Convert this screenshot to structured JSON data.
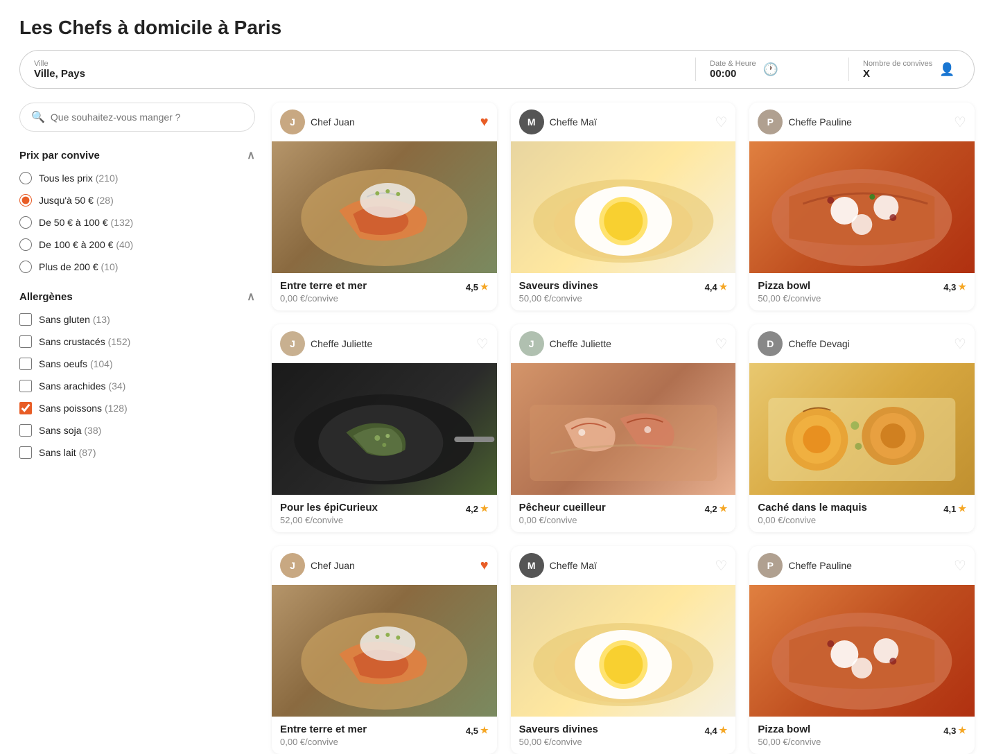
{
  "page": {
    "title": "Les Chefs à domicile à Paris"
  },
  "searchBar": {
    "city_label": "Ville",
    "city_placeholder": "Ville, Pays",
    "city_value": "Ville, Pays",
    "datetime_label": "Date & Heure",
    "datetime_value": "00:00",
    "guests_label": "Nombre de convives",
    "guests_value": "X"
  },
  "sidebar": {
    "search_placeholder": "Que souhaitez-vous manger ?",
    "price_section_label": "Prix par convive",
    "price_options": [
      {
        "id": "all",
        "label": "Tous les prix",
        "count": 210,
        "selected": false
      },
      {
        "id": "under50",
        "label": "Jusqu'à 50 €",
        "count": 28,
        "selected": true
      },
      {
        "id": "50to100",
        "label": "De 50 € à 100 €",
        "count": 132,
        "selected": false
      },
      {
        "id": "100to200",
        "label": "De 100 € à 200 €",
        "count": 40,
        "selected": false
      },
      {
        "id": "over200",
        "label": "Plus de 200 €",
        "count": 10,
        "selected": false
      }
    ],
    "allergens_section_label": "Allergènes",
    "allergen_options": [
      {
        "id": "gluten",
        "label": "Sans gluten",
        "count": 13,
        "checked": false
      },
      {
        "id": "crustaces",
        "label": "Sans crustacés",
        "count": 152,
        "checked": false
      },
      {
        "id": "oeufs",
        "label": "Sans oeufs",
        "count": 104,
        "checked": false
      },
      {
        "id": "arachides",
        "label": "Sans arachides",
        "count": 34,
        "checked": false
      },
      {
        "id": "poissons",
        "label": "Sans poissons",
        "count": 128,
        "checked": true
      },
      {
        "id": "soja",
        "label": "Sans soja",
        "count": 38,
        "checked": false
      },
      {
        "id": "lait",
        "label": "Sans lait",
        "count": 87,
        "checked": false
      }
    ]
  },
  "cards": [
    {
      "chef_name": "Chef Juan",
      "chef_avatar_initials": "J",
      "chef_avatar_color": "#c8a882",
      "dish_name": "Entre terre et mer",
      "price": "0,00 €/convive",
      "rating": "4,5",
      "favorited": true,
      "image_color": "#b5a080",
      "image_secondary": "#7a8a60"
    },
    {
      "chef_name": "Cheffe Maï",
      "chef_avatar_initials": "M",
      "chef_avatar_color": "#555",
      "dish_name": "Saveurs divines",
      "price": "50,00 €/convive",
      "rating": "4,4",
      "favorited": false,
      "image_color": "#e8d5a0",
      "image_secondary": "#ffffff"
    },
    {
      "chef_name": "Cheffe Pauline",
      "chef_avatar_initials": "P",
      "chef_avatar_color": "#b0a090",
      "dish_name": "Pizza bowl",
      "price": "50,00 €/convive",
      "rating": "4,3",
      "favorited": false,
      "image_color": "#e08040",
      "image_secondary": "#cc4422"
    },
    {
      "chef_name": "Cheffe Juliette",
      "chef_avatar_initials": "J",
      "chef_avatar_color": "#c8b090",
      "dish_name": "Pour les épiCurieux",
      "price": "52,00 €/convive",
      "rating": "4,2",
      "favorited": false,
      "image_color": "#2a2a2a",
      "image_secondary": "#5a7040"
    },
    {
      "chef_name": "Cheffe Juliette",
      "chef_avatar_initials": "J",
      "chef_avatar_color": "#b0c0b0",
      "dish_name": "Pêcheur cueilleur",
      "price": "0,00 €/convive",
      "rating": "4,2",
      "favorited": false,
      "image_color": "#d4956a",
      "image_secondary": "#c07050"
    },
    {
      "chef_name": "Cheffe Devagi",
      "chef_avatar_initials": "D",
      "chef_avatar_color": "#888",
      "dish_name": "Caché dans le maquis",
      "price": "0,00 €/convive",
      "rating": "4,1",
      "favorited": false,
      "image_color": "#e8c870",
      "image_secondary": "#c8a840"
    },
    {
      "chef_name": "Chef Juan",
      "chef_avatar_initials": "J",
      "chef_avatar_color": "#c8a882",
      "dish_name": "Entre terre et mer",
      "price": "0,00 €/convive",
      "rating": "4,5",
      "favorited": true,
      "image_color": "#b5a080",
      "image_secondary": "#7a8a60"
    },
    {
      "chef_name": "Cheffe Maï",
      "chef_avatar_initials": "M",
      "chef_avatar_color": "#555",
      "dish_name": "Saveurs divines",
      "price": "50,00 €/convive",
      "rating": "4,4",
      "favorited": false,
      "image_color": "#e8d5a0",
      "image_secondary": "#ffffff"
    },
    {
      "chef_name": "Cheffe Pauline",
      "chef_avatar_initials": "P",
      "chef_avatar_color": "#b0a090",
      "dish_name": "Pizza bowl",
      "price": "50,00 €/convive",
      "rating": "4,3",
      "favorited": false,
      "image_color": "#e08040",
      "image_secondary": "#cc4422"
    }
  ]
}
